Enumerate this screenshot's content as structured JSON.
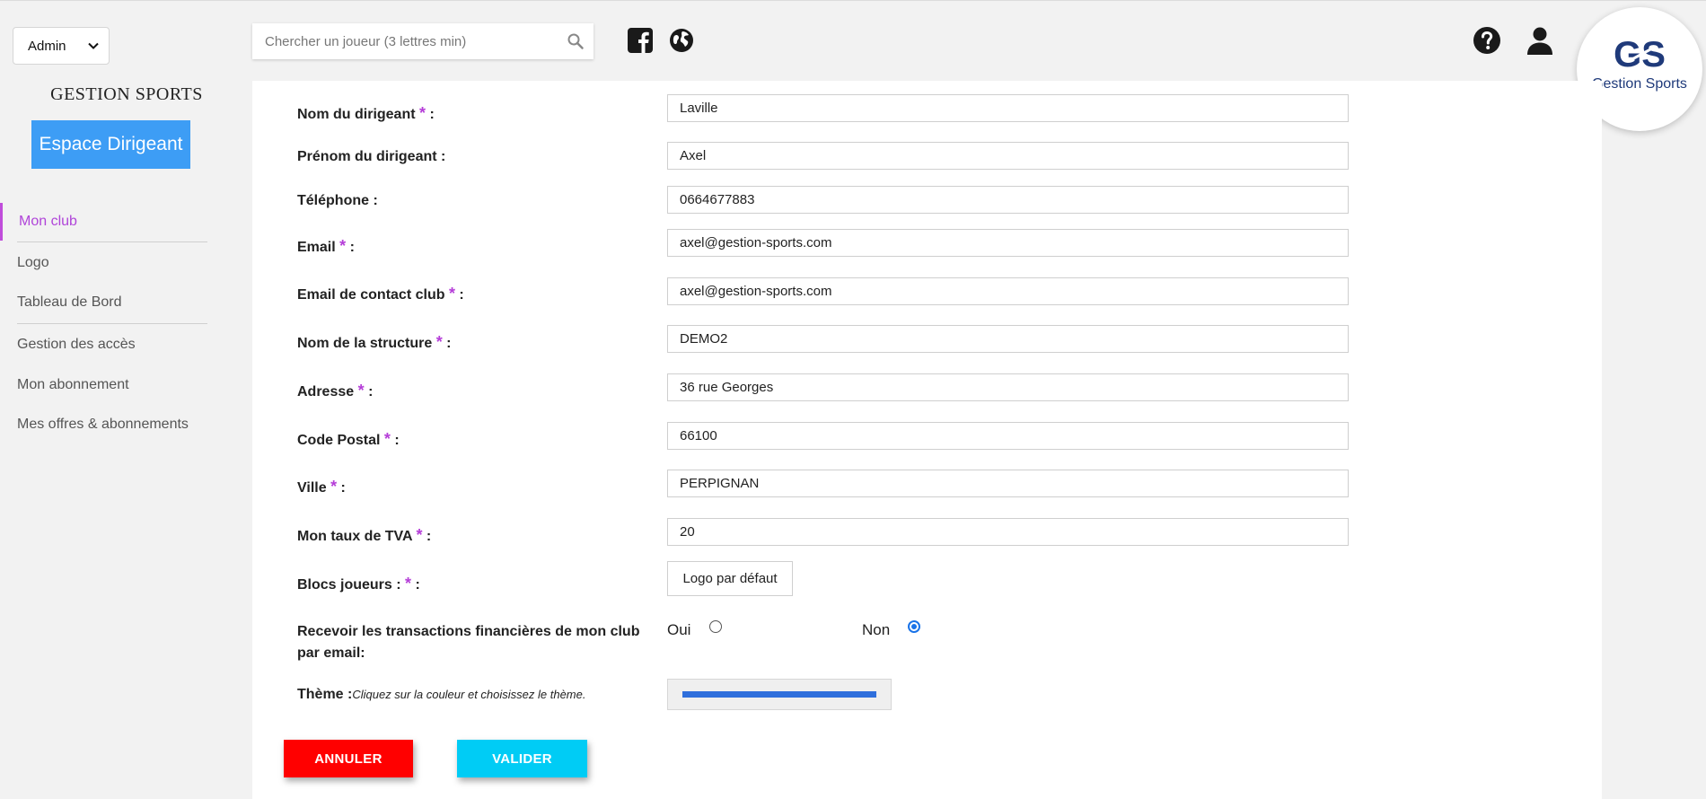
{
  "sidebar": {
    "role_select": "Admin",
    "brand_title": "GESTION SPORTS",
    "space_button": "Espace Dirigeant",
    "nav_items": [
      {
        "label": "Mon club"
      },
      {
        "label": "Logo"
      },
      {
        "label": "Tableau de Bord"
      },
      {
        "label": "Gestion des accès"
      },
      {
        "label": "Mon abonnement"
      },
      {
        "label": "Mes offres & abonnements"
      }
    ]
  },
  "header": {
    "search_placeholder": "Chercher un joueur (3 lettres min)",
    "icons": [
      "facebook-icon",
      "globe-icon",
      "help-icon",
      "user-icon"
    ],
    "logo_text": "Gestion Sports",
    "logo_letters": "GS"
  },
  "form": {
    "nom_dirigeant": {
      "label": "Nom du dirigeant",
      "suffix": " :",
      "value": "Laville"
    },
    "prenom_dirigeant": {
      "label": "Prénom du dirigeant :",
      "value": "Axel"
    },
    "telephone": {
      "label": "Téléphone :",
      "value": "0664677883"
    },
    "email": {
      "label": "Email",
      "suffix": " :",
      "value": "axel@gestion-sports.com"
    },
    "email_contact": {
      "label": "Email de contact club",
      "suffix": " :",
      "value": "axel@gestion-sports.com"
    },
    "nom_structure": {
      "label": "Nom de la structure",
      "suffix": " :",
      "value": "DEMO2"
    },
    "adresse": {
      "label": "Adresse",
      "suffix": " :",
      "value": "36 rue Georges"
    },
    "code_postal": {
      "label": "Code Postal",
      "suffix": " :",
      "value": "66100"
    },
    "ville": {
      "label": "Ville",
      "suffix": " :",
      "value": "PERPIGNAN"
    },
    "tva": {
      "label": "Mon taux de TVA",
      "suffix": " :",
      "value": "20"
    },
    "blocs_joueurs": {
      "label": "Blocs joueurs :",
      "suffix": " :",
      "value": "Logo par défaut"
    },
    "transactions": {
      "label_line1": "Recevoir les transactions financières de mon club",
      "label_line2": "par email:",
      "option_yes": "Oui",
      "option_no": "Non",
      "selected": "Non"
    },
    "theme": {
      "label": "Thème :",
      "hint": "Cliquez sur la couleur et choisissez le thème.",
      "color": "#2f6fdc"
    },
    "required_mark": "*"
  },
  "actions": {
    "cancel": "ANNULER",
    "submit": "VALIDER",
    "cancel_color": "#ff0000",
    "submit_color": "#00ccf5"
  },
  "colors": {
    "accent": "#b045d9",
    "primary_button": "#3d9df5",
    "brand_navy": "#1f3a7a"
  }
}
